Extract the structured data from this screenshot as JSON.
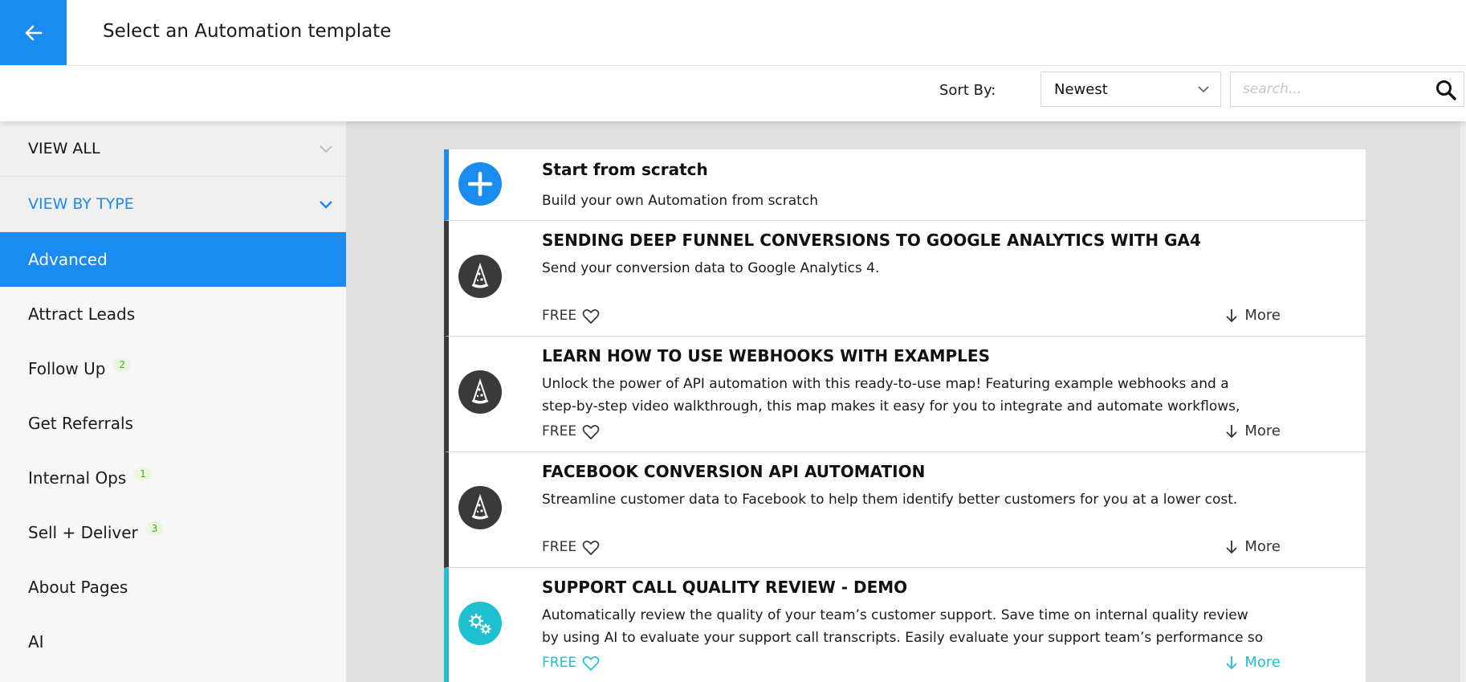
{
  "header": {
    "title": "Select an Automation template"
  },
  "toolbar": {
    "sort_label": "Sort By:",
    "sort_value": "Newest",
    "search_placeholder": "search..."
  },
  "sidebar": {
    "view_all": "VIEW ALL",
    "view_by_type": "VIEW BY TYPE",
    "items": [
      {
        "label": "Advanced",
        "count": ""
      },
      {
        "label": "Attract Leads",
        "count": ""
      },
      {
        "label": "Follow Up",
        "count": "2"
      },
      {
        "label": "Get Referrals",
        "count": ""
      },
      {
        "label": "Internal Ops",
        "count": "1"
      },
      {
        "label": "Sell + Deliver",
        "count": "3"
      },
      {
        "label": "About Pages",
        "count": ""
      },
      {
        "label": "AI",
        "count": ""
      }
    ]
  },
  "cards": [
    {
      "title": "Start from scratch",
      "description": "Build your own Automation from scratch"
    },
    {
      "title": "SENDING DEEP FUNNEL CONVERSIONS TO GOOGLE ANALYTICS WITH GA4",
      "description": "Send your conversion data to Google Analytics 4.",
      "price": "FREE",
      "more": "More"
    },
    {
      "title": "LEARN HOW TO USE WEBHOOKS WITH EXAMPLES",
      "description": "Unlock the power of API automation with this ready-to-use map! Featuring example webhooks and a step-by-step video walkthrough, this map makes it easy for you to integrate and automate workflows, even if",
      "price": "FREE",
      "more": "More"
    },
    {
      "title": "FACEBOOK CONVERSION API AUTOMATION",
      "description": "Streamline customer data to Facebook to help them identify better customers for you at a lower cost.",
      "price": "FREE",
      "more": "More"
    },
    {
      "title": "SUPPORT CALL QUALITY REVIEW - DEMO",
      "description": "Automatically review the quality of your team’s customer support. Save time on internal quality review by using AI to evaluate your support call transcripts. Easily evaluate your support team’s performance so you",
      "price": "FREE",
      "more": "More"
    }
  ],
  "colors": {
    "accent": "#1a8cf0",
    "teal": "#1ec0d0",
    "badge_green": "#4fa62a",
    "dark_icon": "#3a3a3a"
  },
  "icons": {
    "back": "arrow-left-icon",
    "sort": "chevron-down-icon",
    "search": "search-icon",
    "scratch": "plus-icon",
    "wizard": "wizard-hat-icon",
    "gears": "gears-icon",
    "heart": "heart-icon",
    "more": "arrow-down-icon"
  }
}
